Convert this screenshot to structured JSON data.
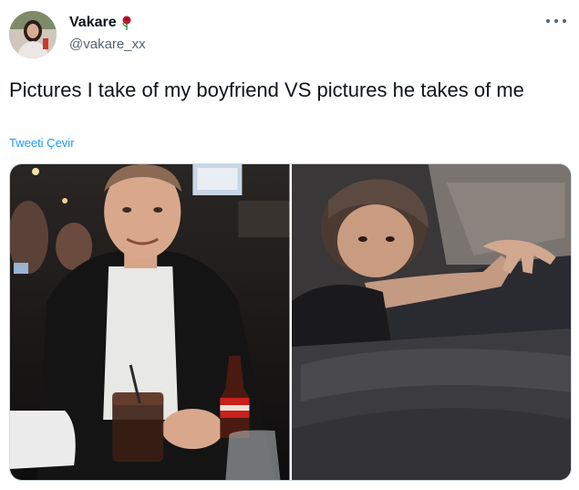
{
  "user": {
    "display_name": "Vakare",
    "handle": "@vakare_xx",
    "name_emoji": "rose-icon"
  },
  "tweet": {
    "text": "Pictures I take of my boyfriend VS pictures he takes of me",
    "translate_label": "Tweeti Çevir"
  },
  "media": {
    "photos": [
      {
        "name": "boyfriend-photo",
        "alt": ""
      },
      {
        "name": "girlfriend-photo",
        "alt": ""
      }
    ]
  },
  "colors": {
    "link": "#1d9bf0",
    "secondary_text": "#536471",
    "primary_text": "#0f1419"
  }
}
